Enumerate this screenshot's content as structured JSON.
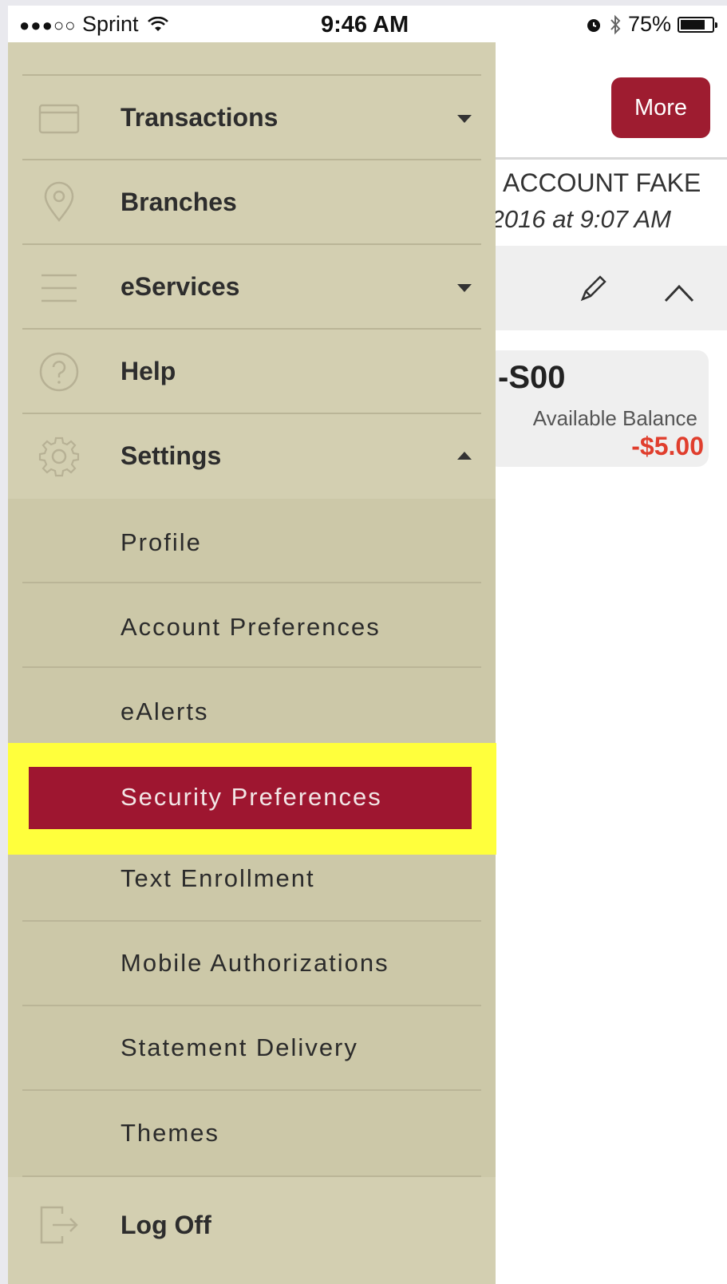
{
  "status_bar": {
    "signal_dots": "●●●○○",
    "carrier": "Sprint",
    "time": "9:46 AM",
    "battery": "75%"
  },
  "header": {
    "more_label": "More"
  },
  "account": {
    "name": "ACCOUNT FAKE",
    "updated": "/2016 at 9:07 AM",
    "amount": "-S00",
    "balance_label": "Available Balance",
    "balance_value": "-$5.00"
  },
  "menu": {
    "transactions": "Transactions",
    "branches": "Branches",
    "eservices": "eServices",
    "help": "Help",
    "settings": "Settings",
    "settings_items": {
      "profile": "Profile",
      "account_preferences": "Account Preferences",
      "ealerts": "eAlerts",
      "security_preferences": "Security Preferences",
      "text_enrollment": "Text Enrollment",
      "mobile_authorizations": "Mobile Authorizations",
      "statement_delivery": "Statement Delivery",
      "themes": "Themes"
    },
    "log_off": "Log Off"
  },
  "colors": {
    "drawer_bg": "#d3cfb1",
    "submenu_bg": "#ccc8a8",
    "brand_red": "#9e1c30",
    "highlight": "#ffff3c",
    "negative": "#e03e2d"
  }
}
